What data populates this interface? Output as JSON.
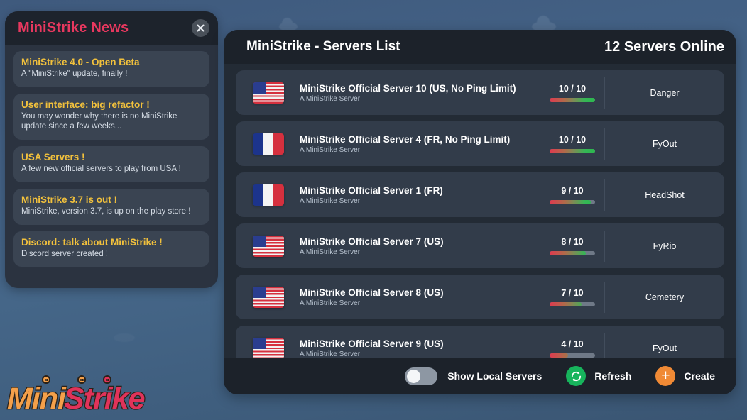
{
  "news": {
    "title": "MiniStrike News",
    "close_icon": "close-icon",
    "items": [
      {
        "title": "MiniStrike 4.0 - Open Beta",
        "desc": "A \"MiniStrike\" update, finally !"
      },
      {
        "title": "User interface: big refactor !",
        "desc": "You may wonder why there is no MiniStrike update since a few weeks..."
      },
      {
        "title": "USA Servers !",
        "desc": "A few new official servers to play from USA !"
      },
      {
        "title": "MiniStrike 3.7 is out !",
        "desc": "MiniStrike, version 3.7, is up on the play store !"
      },
      {
        "title": "Discord: talk about MiniStrike !",
        "desc": "Discord server created !"
      }
    ]
  },
  "servers": {
    "header_title": "MiniStrike - Servers List",
    "online_count": "12 Servers Online",
    "rows": [
      {
        "flag": "us",
        "name": "MiniStrike Official Server 10 (US, No Ping Limit)",
        "sub": "A MiniStrike Server",
        "players": "10 / 10",
        "fill_pct": 100,
        "map": "Danger"
      },
      {
        "flag": "fr",
        "name": "MiniStrike Official Server 4 (FR, No Ping Limit)",
        "sub": "A MiniStrike Server",
        "players": "10 / 10",
        "fill_pct": 100,
        "map": "FyOut"
      },
      {
        "flag": "fr",
        "name": "MiniStrike Official Server 1 (FR)",
        "sub": "A MiniStrike Server",
        "players": "9 / 10",
        "fill_pct": 90,
        "map": "HeadShot"
      },
      {
        "flag": "us",
        "name": "MiniStrike Official Server 7 (US)",
        "sub": "A MiniStrike Server",
        "players": "8 / 10",
        "fill_pct": 80,
        "map": "FyRio"
      },
      {
        "flag": "us",
        "name": "MiniStrike Official Server 8 (US)",
        "sub": "A MiniStrike Server",
        "players": "7 / 10",
        "fill_pct": 70,
        "map": "Cemetery"
      },
      {
        "flag": "us",
        "name": "MiniStrike Official Server 9 (US)",
        "sub": "A MiniStrike Server",
        "players": "4 / 10",
        "fill_pct": 40,
        "map": "FyOut"
      }
    ]
  },
  "bottom_bar": {
    "toggle_label": "Show Local Servers",
    "toggle_state": "off",
    "refresh_label": "Refresh",
    "refresh_icon": "refresh-icon",
    "create_label": "Create",
    "create_icon": "plus-icon"
  },
  "logo": {
    "part1": "Mini",
    "part2": "Strike"
  },
  "colors": {
    "accent_pink": "#e0335a",
    "accent_orange": "#f4a04a",
    "news_title_yellow": "#f2c13c",
    "refresh_green": "#17b45c",
    "create_orange": "#f08a35"
  }
}
